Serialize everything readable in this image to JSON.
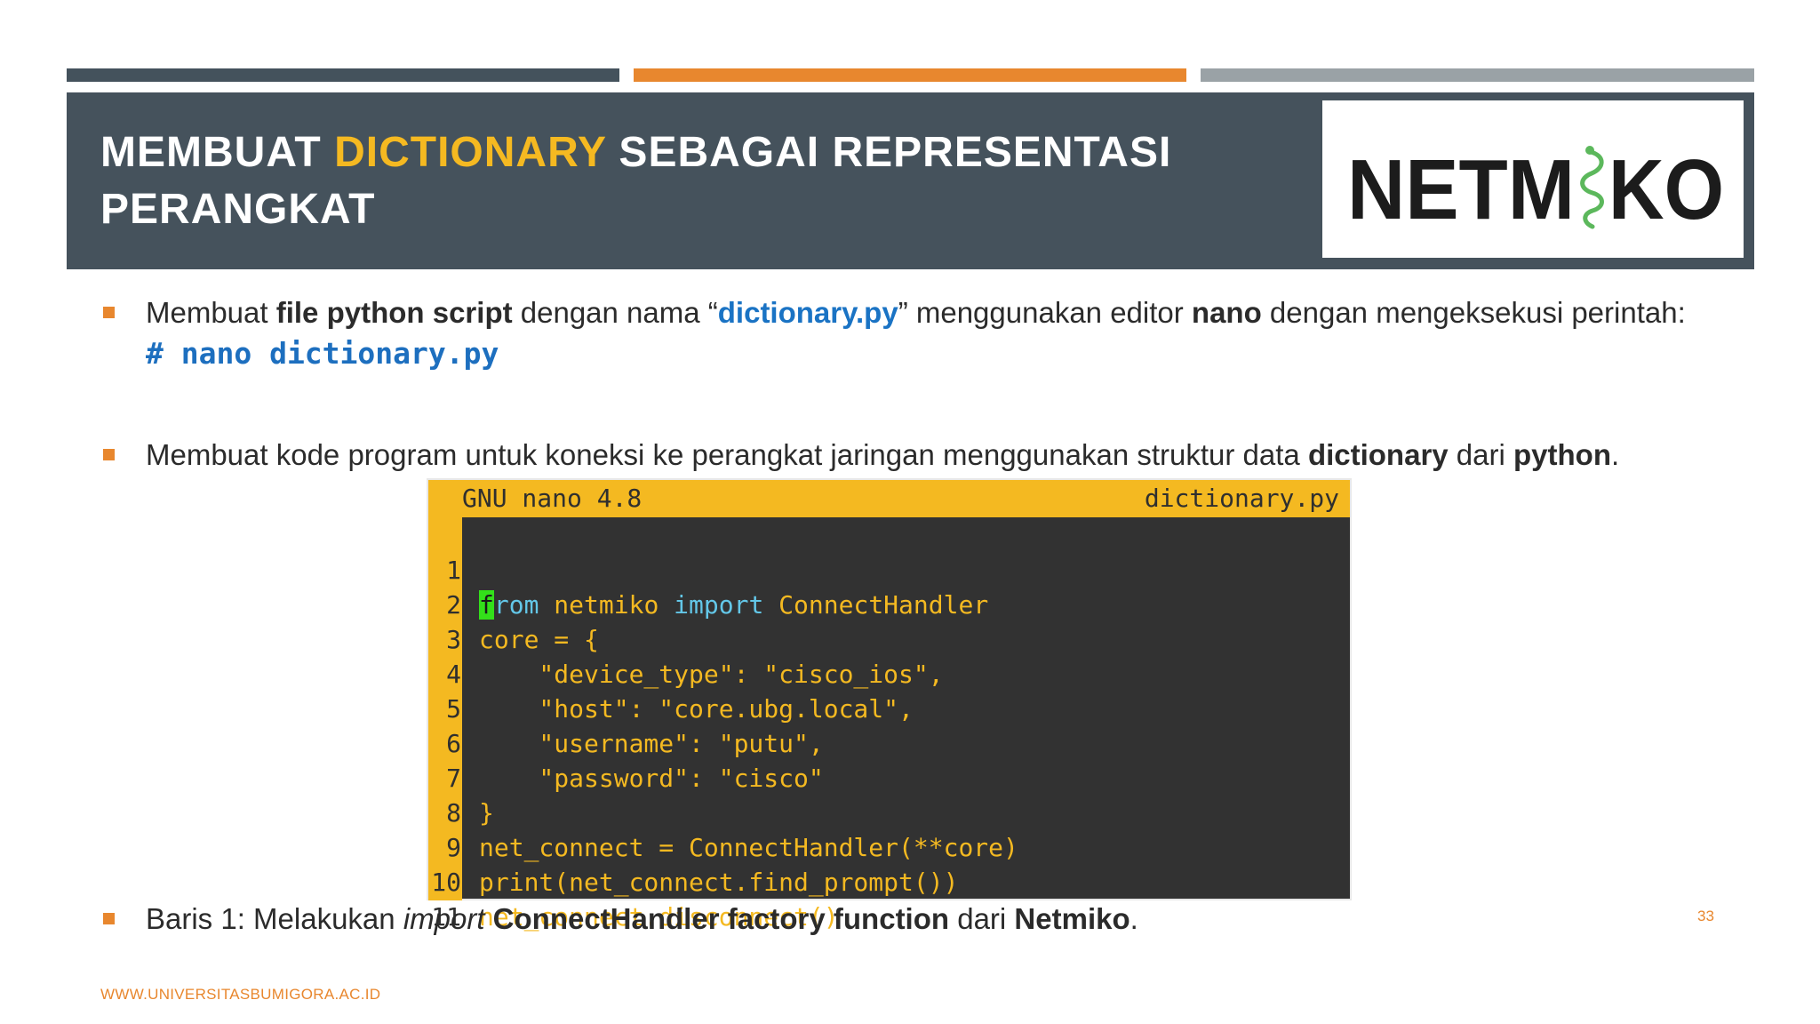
{
  "header": {
    "title_part1": "MEMBUAT ",
    "title_highlight": "DICTIONARY",
    "title_part2": " SEBAGAI REPRESENTASI PERANGKAT"
  },
  "logo": {
    "text_left": "NETM",
    "text_right": "KO",
    "icon": "snake-icon"
  },
  "bullets": [
    {
      "t1": "Membuat ",
      "b1": "file python script",
      "t2": " dengan nama “",
      "link": "dictionary.py",
      "t3": "” menggunakan editor ",
      "b2": "nano",
      "t4": " dengan mengeksekusi perintah:",
      "command": "# nano dictionary.py"
    },
    {
      "t1": "Membuat kode program untuk koneksi ke perangkat jaringan menggunakan struktur data ",
      "b1": "dictionary",
      "t2": " dari ",
      "b2": "python",
      "t3": "."
    },
    {
      "t1": "Baris 1: Melakukan ",
      "i1": "import",
      "t2": " ",
      "b1": "ConnectHandler factory function",
      "t3": " dari ",
      "b2": "Netmiko",
      "t4": "."
    }
  ],
  "terminal": {
    "app": "GNU nano 4.8",
    "filename": "dictionary.py",
    "line1": {
      "num": "1",
      "cursor_char": "f",
      "kw1": "rom",
      "mid": " netmiko ",
      "kw2": "import",
      "rest": " ConnectHandler"
    },
    "lines": [
      {
        "num": "2",
        "code": "core = {"
      },
      {
        "num": "3",
        "code": "    \"device_type\": \"cisco_ios\","
      },
      {
        "num": "4",
        "code": "    \"host\": \"core.ubg.local\","
      },
      {
        "num": "5",
        "code": "    \"username\": \"putu\","
      },
      {
        "num": "6",
        "code": "    \"password\": \"cisco\""
      },
      {
        "num": "7",
        "code": "}"
      },
      {
        "num": "8",
        "code": "net_connect = ConnectHandler(**core)"
      },
      {
        "num": "9",
        "code": "print(net_connect.find_prompt())"
      },
      {
        "num": "10",
        "code": "net_connect.disconnect()"
      },
      {
        "num": "11",
        "code": ""
      }
    ]
  },
  "page_number": "33",
  "footer_url": "WWW.UNIVERSITASBUMIGORA.AC.ID",
  "colors": {
    "dark": "#45525c",
    "orange": "#e8872e",
    "yellow": "#f5b921",
    "blue": "#1a73c4"
  }
}
